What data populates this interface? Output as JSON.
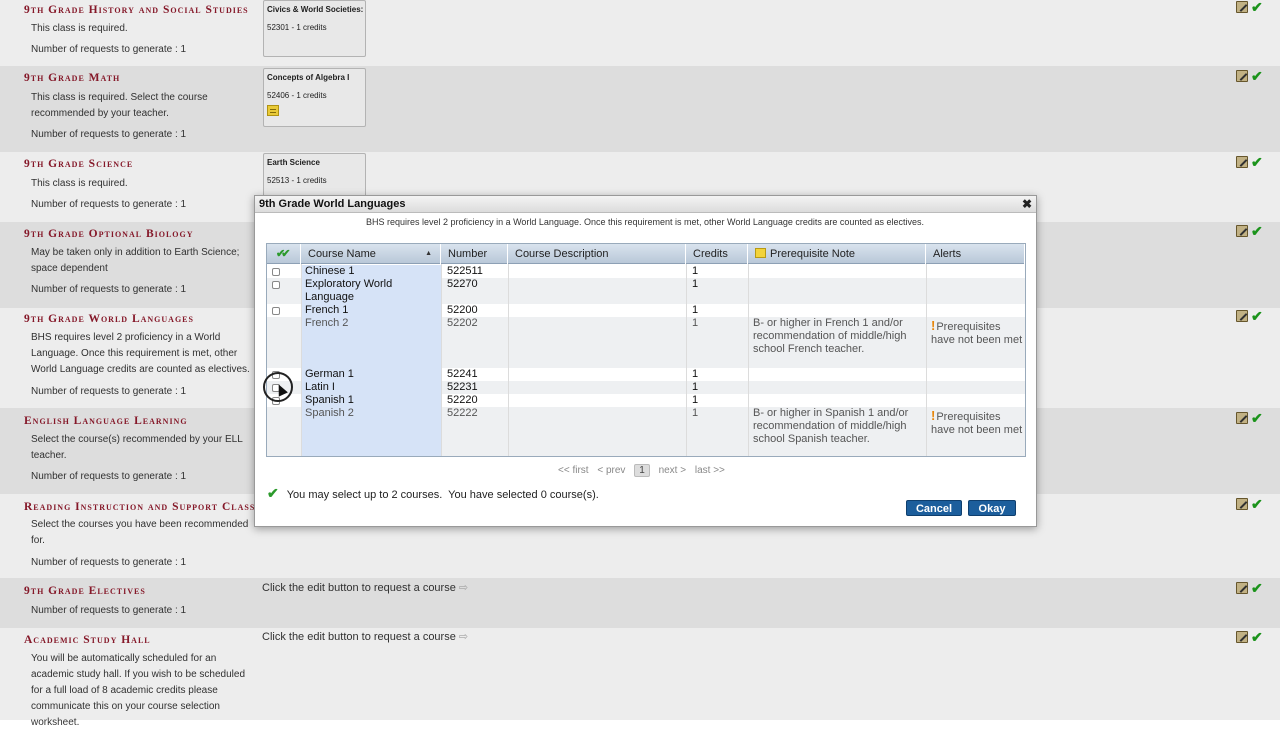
{
  "requirements": [
    {
      "title": "9th Grade History and Social Studies",
      "desc": "This class is required.",
      "count": "Number of requests to generate : 1",
      "course": {
        "name": "Civics & World Societies: H",
        "number": "52301 - 1 credits"
      }
    },
    {
      "title": "9th Grade Math",
      "desc": "This class is required. Select the course recommended by your teacher.",
      "count": "Number of requests to generate : 1",
      "course": {
        "name": "Concepts of Algebra I",
        "number": "52406 - 1 credits"
      }
    },
    {
      "title": "9th Grade Science",
      "desc": "This class is required.",
      "count": "Number of requests to generate : 1",
      "course": {
        "name": "Earth Science",
        "number": "52513 - 1 credits"
      }
    },
    {
      "title": "9th Grade Optional Biology",
      "desc": "May be taken only in addition to Earth Science; space dependent",
      "count": "Number of requests to generate : 1"
    },
    {
      "title": "9th Grade World Languages",
      "desc": "BHS requires level 2 proficiency in a World Language. Once this requirement is met, other World Language credits are counted as electives.",
      "count": "Number of requests to generate : 1"
    },
    {
      "title": "English Language Learning",
      "desc": "Select the course(s) recommended by your ELL teacher.",
      "count": "Number of requests to generate : 1"
    },
    {
      "title": "Reading Instruction and Support Classes",
      "desc": "Select the courses you have been recommended for.",
      "count": "Number of requests to generate : 1"
    },
    {
      "title": "9th Grade Electives",
      "desc": "",
      "count": "Number of requests to generate : 1",
      "hint": "Click the edit button to request a course"
    },
    {
      "title": "Academic Study Hall",
      "desc": "You will be automatically scheduled for an academic study hall. If you wish to be scheduled for a full load of 8 academic credits please communicate this on your course selection worksheet.",
      "count": "",
      "hint": "Click the edit button to request a course"
    }
  ],
  "icons": {
    "edit": "edit-pencil-icon",
    "check": "green-check-icon",
    "note": "sticky-note-icon",
    "arrow": "right-arrow-icon",
    "alert": "exclamation-icon",
    "close": "close-icon"
  },
  "dialog": {
    "title": "9th Grade World Languages",
    "close_glyph": "✖",
    "intro": "BHS requires level 2 proficiency in a World Language. Once this requirement is met, other World Language credits are counted as electives.",
    "columns": {
      "name": "Course Name",
      "number": "Number",
      "description": "Course Description",
      "credits": "Credits",
      "prereq": "Prerequisite Note",
      "alerts": "Alerts"
    },
    "rows": [
      {
        "name": "Chinese 1",
        "number": "522511",
        "description": "",
        "credits": "1",
        "prereq": "",
        "alert": "",
        "selectable": true
      },
      {
        "name": "Exploratory World Language",
        "number": "52270",
        "description": "",
        "credits": "1",
        "prereq": "",
        "alert": "",
        "selectable": true
      },
      {
        "name": "French 1",
        "number": "52200",
        "description": "",
        "credits": "1",
        "prereq": "",
        "alert": "",
        "selectable": true
      },
      {
        "name": "French 2",
        "number": "52202",
        "description": "",
        "credits": "1",
        "prereq": "B- or higher in French 1 and/or recommendation of middle/high school French teacher.",
        "alert": "Prerequisites have not been met",
        "selectable": false
      },
      {
        "name": "German 1",
        "number": "52241",
        "description": "",
        "credits": "1",
        "prereq": "",
        "alert": "",
        "selectable": true
      },
      {
        "name": "Latin I",
        "number": "52231",
        "description": "",
        "credits": "1",
        "prereq": "",
        "alert": "",
        "selectable": true
      },
      {
        "name": "Spanish 1",
        "number": "52220",
        "description": "",
        "credits": "1",
        "prereq": "",
        "alert": "",
        "selectable": true
      },
      {
        "name": "Spanish 2",
        "number": "52222",
        "description": "",
        "credits": "1",
        "prereq": "B- or higher in Spanish 1 and/or recommendation of middle/high school Spanish teacher.",
        "alert": "Prerequisites have not been met",
        "selectable": false
      }
    ],
    "pager": {
      "first": "<< first",
      "prev": "< prev",
      "current": "1",
      "next": "next >",
      "last": "last >>"
    },
    "status": "You may select up to 2 courses.  You have selected 0 course(s).",
    "buttons": {
      "cancel": "Cancel",
      "okay": "Okay"
    }
  }
}
